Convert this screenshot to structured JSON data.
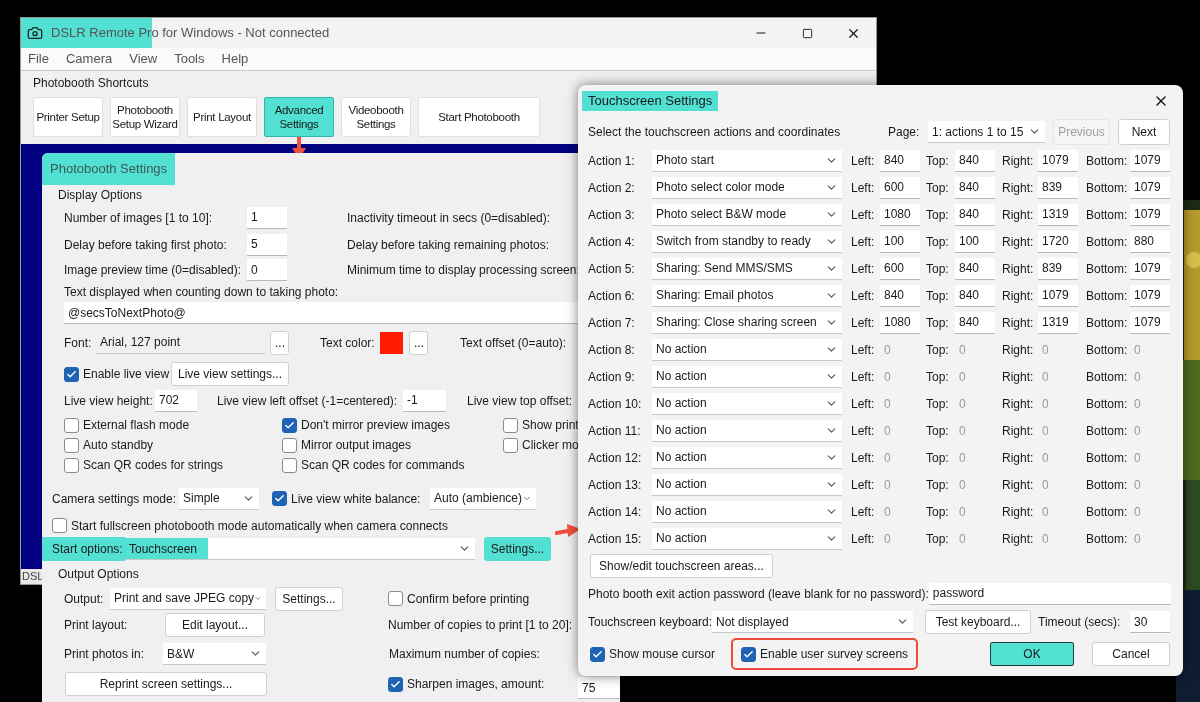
{
  "main_window": {
    "title": "DSLR Remote Pro for Windows - Not connected",
    "title_highlighted": true,
    "menu": [
      "File",
      "Camera",
      "View",
      "Tools",
      "Help"
    ],
    "shortcuts": {
      "label": "Photobooth Shortcuts",
      "buttons": [
        {
          "label": "Printer Setup",
          "highlighted": false
        },
        {
          "label": "Photobooth Setup Wizard",
          "highlighted": false
        },
        {
          "label": "Print Layout",
          "highlighted": false
        },
        {
          "label": "Advanced Settings",
          "highlighted": true,
          "arrow_below": true
        },
        {
          "label": "Videobooth Settings",
          "highlighted": false
        },
        {
          "label": "Start Photobooth",
          "highlighted": false
        }
      ]
    },
    "status_text": "DSL"
  },
  "photobooth_settings": {
    "title": "Photobooth Settings",
    "title_highlighted": true,
    "display_options": {
      "label": "Display Options",
      "number_rows": [
        {
          "label": "Number of images [1 to 10]:",
          "value": "1",
          "right_label": "Inactivity timeout in secs (0=disabled):"
        },
        {
          "label": "Delay before taking first photo:",
          "value": "5",
          "right_label": "Delay before taking remaining photos:"
        },
        {
          "label": "Image preview time (0=disabled):",
          "value": "0",
          "right_label": "Minimum time to display processing screen:"
        }
      ],
      "countdown_label": "Text displayed when counting down to taking photo:",
      "countdown_text": "@secsToNextPhoto@",
      "font": {
        "label": "Font:",
        "value": "Arial, 127 point",
        "button": "..."
      },
      "text_color": {
        "label": "Text color:",
        "color": "#ff1a00",
        "button": "..."
      },
      "text_offset_label": "Text offset (0=auto):",
      "live_view": {
        "label": "Enable live view",
        "checked": true,
        "button": "Live view settings..."
      },
      "live_view_height": {
        "label": "Live view height:",
        "value": "702"
      },
      "live_view_left": {
        "label": "Live view left offset (-1=centered):",
        "value": "-1"
      },
      "live_view_top_label": "Live view top offset:",
      "checkbox_columns": [
        [
          {
            "label": "External flash mode",
            "checked": false
          },
          {
            "label": "Auto standby",
            "checked": false
          },
          {
            "label": "Scan QR codes for strings",
            "checked": false
          }
        ],
        [
          {
            "label": "Don't mirror preview images",
            "checked": true
          },
          {
            "label": "Mirror output images",
            "checked": false
          },
          {
            "label": "Scan QR codes for commands",
            "checked": false
          }
        ],
        [
          {
            "label": "Show print",
            "checked": false
          },
          {
            "label": "Clicker mo",
            "checked": false
          }
        ]
      ],
      "camera_settings_mode": {
        "label": "Camera settings mode:",
        "value": "Simple"
      },
      "white_balance": {
        "label": "Live view white balance:",
        "checked": true,
        "value": "Auto (ambience)"
      },
      "autostart": {
        "label": "Start fullscreen photobooth mode automatically when camera connects",
        "checked": false
      },
      "start_options": {
        "label": "Start options:",
        "value": "Touchscreen",
        "highlighted": true,
        "button": {
          "label": "Settings...",
          "highlighted": true,
          "arrow_right": true
        }
      }
    },
    "output_options": {
      "label": "Output Options",
      "output": {
        "label": "Output:",
        "value": "Print and save JPEG copy",
        "button": "Settings..."
      },
      "confirm": {
        "label": "Confirm before printing",
        "checked": false
      },
      "print_layout": {
        "label": "Print layout:",
        "button": "Edit layout..."
      },
      "copies_label": "Number of copies to print [1 to 20]:",
      "print_photos_in": {
        "label": "Print photos in:",
        "value": "B&W"
      },
      "max_copies_label": "Maximum number of copies:",
      "reprint_button": "Reprint screen settings...",
      "sharpen": {
        "label": "Sharpen images, amount:",
        "checked": true,
        "value": "75"
      }
    }
  },
  "touchscreen_dialog": {
    "title": "Touchscreen Settings",
    "title_highlighted": true,
    "instructions": "Select the touchscreen actions and coordinates",
    "page": {
      "label": "Page:",
      "value": "1: actions 1 to 15"
    },
    "previous": {
      "label": "Previous",
      "disabled": true
    },
    "next": {
      "label": "Next",
      "disabled": false
    },
    "actions": [
      {
        "label": "Action 1:",
        "action": "Photo start",
        "disabled": false,
        "coords": [
          {
            "label": "Left:",
            "value": "840"
          },
          {
            "label": "Top:",
            "value": "840"
          },
          {
            "label": "Right:",
            "value": "1079"
          },
          {
            "label": "Bottom:",
            "value": "1079"
          }
        ]
      },
      {
        "label": "Action 2:",
        "action": "Photo select color mode",
        "disabled": false,
        "coords": [
          {
            "label": "Left:",
            "value": "600"
          },
          {
            "label": "Top:",
            "value": "840"
          },
          {
            "label": "Right:",
            "value": "839"
          },
          {
            "label": "Bottom:",
            "value": "1079"
          }
        ]
      },
      {
        "label": "Action 3:",
        "action": "Photo select B&W mode",
        "disabled": false,
        "coords": [
          {
            "label": "Left:",
            "value": "1080"
          },
          {
            "label": "Top:",
            "value": "840"
          },
          {
            "label": "Right:",
            "value": "1319"
          },
          {
            "label": "Bottom:",
            "value": "1079"
          }
        ]
      },
      {
        "label": "Action 4:",
        "action": "Switch from standby to ready",
        "disabled": false,
        "coords": [
          {
            "label": "Left:",
            "value": "100"
          },
          {
            "label": "Top:",
            "value": "100"
          },
          {
            "label": "Right:",
            "value": "1720"
          },
          {
            "label": "Bottom:",
            "value": "880"
          }
        ]
      },
      {
        "label": "Action 5:",
        "action": "Sharing: Send MMS/SMS",
        "disabled": false,
        "coords": [
          {
            "label": "Left:",
            "value": "600"
          },
          {
            "label": "Top:",
            "value": "840"
          },
          {
            "label": "Right:",
            "value": "839"
          },
          {
            "label": "Bottom:",
            "value": "1079"
          }
        ]
      },
      {
        "label": "Action 6:",
        "action": "Sharing: Email photos",
        "disabled": false,
        "coords": [
          {
            "label": "Left:",
            "value": "840"
          },
          {
            "label": "Top:",
            "value": "840"
          },
          {
            "label": "Right:",
            "value": "1079"
          },
          {
            "label": "Bottom:",
            "value": "1079"
          }
        ]
      },
      {
        "label": "Action 7:",
        "action": "Sharing: Close sharing screen",
        "disabled": false,
        "coords": [
          {
            "label": "Left:",
            "value": "1080"
          },
          {
            "label": "Top:",
            "value": "840"
          },
          {
            "label": "Right:",
            "value": "1319"
          },
          {
            "label": "Bottom:",
            "value": "1079"
          }
        ]
      },
      {
        "label": "Action 8:",
        "action": "No action",
        "disabled": true,
        "coords": [
          {
            "label": "Left:",
            "value": "0"
          },
          {
            "label": "Top:",
            "value": "0"
          },
          {
            "label": "Right:",
            "value": "0"
          },
          {
            "label": "Bottom:",
            "value": "0"
          }
        ]
      },
      {
        "label": "Action 9:",
        "action": "No action",
        "disabled": true,
        "coords": [
          {
            "label": "Left:",
            "value": "0"
          },
          {
            "label": "Top:",
            "value": "0"
          },
          {
            "label": "Right:",
            "value": "0"
          },
          {
            "label": "Bottom:",
            "value": "0"
          }
        ]
      },
      {
        "label": "Action 10:",
        "action": "No action",
        "disabled": true,
        "coords": [
          {
            "label": "Left:",
            "value": "0"
          },
          {
            "label": "Top:",
            "value": "0"
          },
          {
            "label": "Right:",
            "value": "0"
          },
          {
            "label": "Bottom:",
            "value": "0"
          }
        ]
      },
      {
        "label": "Action 11:",
        "action": "No action",
        "disabled": true,
        "coords": [
          {
            "label": "Left:",
            "value": "0"
          },
          {
            "label": "Top:",
            "value": "0"
          },
          {
            "label": "Right:",
            "value": "0"
          },
          {
            "label": "Bottom:",
            "value": "0"
          }
        ]
      },
      {
        "label": "Action 12:",
        "action": "No action",
        "disabled": true,
        "coords": [
          {
            "label": "Left:",
            "value": "0"
          },
          {
            "label": "Top:",
            "value": "0"
          },
          {
            "label": "Right:",
            "value": "0"
          },
          {
            "label": "Bottom:",
            "value": "0"
          }
        ]
      },
      {
        "label": "Action 13:",
        "action": "No action",
        "disabled": true,
        "coords": [
          {
            "label": "Left:",
            "value": "0"
          },
          {
            "label": "Top:",
            "value": "0"
          },
          {
            "label": "Right:",
            "value": "0"
          },
          {
            "label": "Bottom:",
            "value": "0"
          }
        ]
      },
      {
        "label": "Action 14:",
        "action": "No action",
        "disabled": true,
        "coords": [
          {
            "label": "Left:",
            "value": "0"
          },
          {
            "label": "Top:",
            "value": "0"
          },
          {
            "label": "Right:",
            "value": "0"
          },
          {
            "label": "Bottom:",
            "value": "0"
          }
        ]
      },
      {
        "label": "Action 15:",
        "action": "No action",
        "disabled": true,
        "coords": [
          {
            "label": "Left:",
            "value": "0"
          },
          {
            "label": "Top:",
            "value": "0"
          },
          {
            "label": "Right:",
            "value": "0"
          },
          {
            "label": "Bottom:",
            "value": "0"
          }
        ]
      }
    ],
    "areas_button": "Show/edit touchscreen areas...",
    "password": {
      "label": "Photo booth exit action password (leave blank for no password):",
      "value": "password"
    },
    "keyboard": {
      "label": "Touchscreen keyboard:",
      "value": "Not displayed",
      "button": "Test keyboard..."
    },
    "timeout": {
      "label": "Timeout (secs):",
      "value": "30"
    },
    "show_cursor": {
      "label": "Show mouse cursor",
      "checked": true
    },
    "survey": {
      "label": "Enable user survey screens",
      "checked": true,
      "outlined": true
    },
    "ok": {
      "label": "OK",
      "highlighted": true
    },
    "cancel": {
      "label": "Cancel"
    }
  }
}
